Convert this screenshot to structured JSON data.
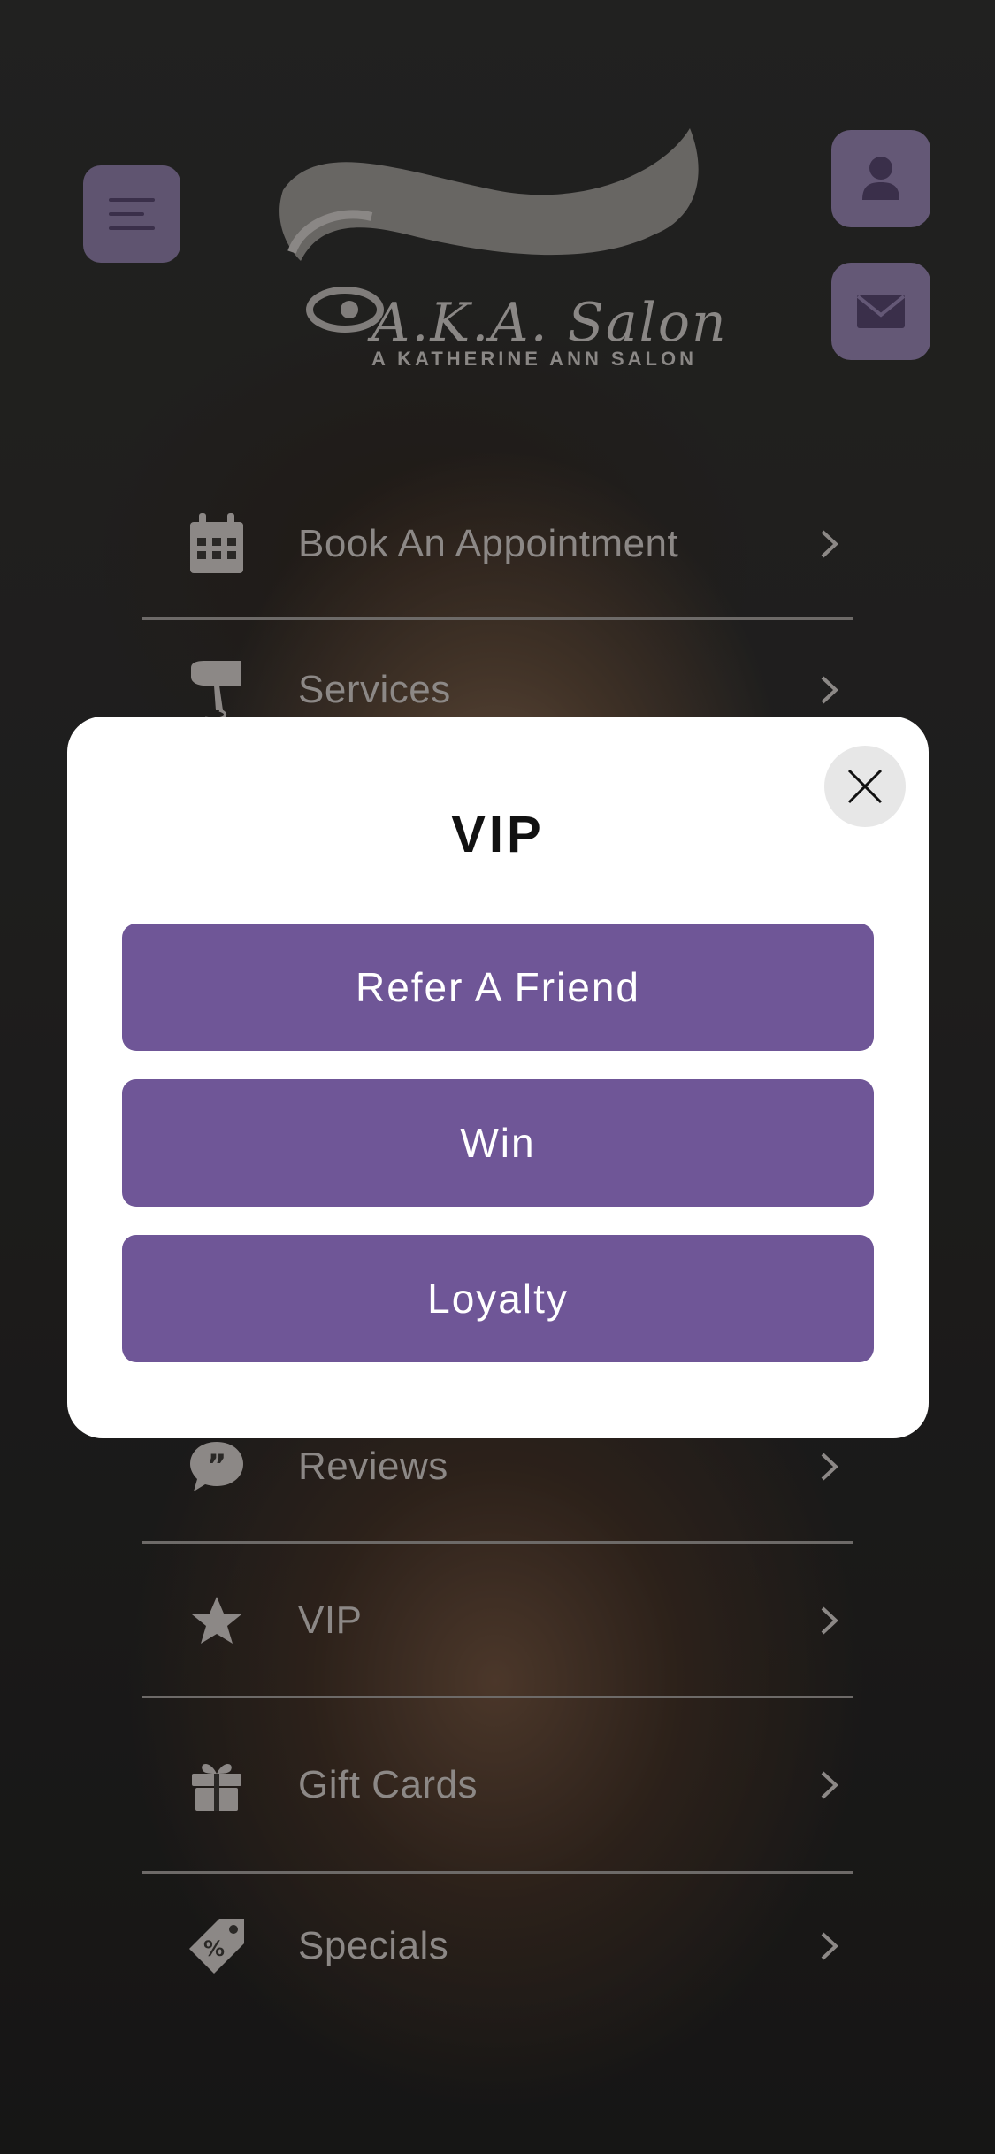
{
  "header": {
    "logo_title": "A.K.A. Salon",
    "logo_subtitle": "A KATHERINE ANN SALON",
    "menu_icon": "hamburger-icon",
    "user_icon": "user-icon",
    "mail_icon": "envelope-icon"
  },
  "menu": {
    "items": [
      {
        "label": "Book An Appointment",
        "icon": "calendar-icon"
      },
      {
        "label": "Services",
        "icon": "hair-dryer-icon"
      },
      {
        "label": "Reviews",
        "icon": "quote-bubble-icon"
      },
      {
        "label": "VIP",
        "icon": "star-icon"
      },
      {
        "label": "Gift Cards",
        "icon": "gift-icon"
      },
      {
        "label": "Specials",
        "icon": "price-tag-icon"
      }
    ]
  },
  "modal": {
    "title": "VIP",
    "buttons": [
      {
        "label": "Refer A Friend"
      },
      {
        "label": "Win"
      },
      {
        "label": "Loyalty"
      }
    ],
    "close_icon": "close-icon"
  },
  "colors": {
    "accent": "#6f5697",
    "header_button": "#645876",
    "modal_bg": "#ffffff"
  }
}
